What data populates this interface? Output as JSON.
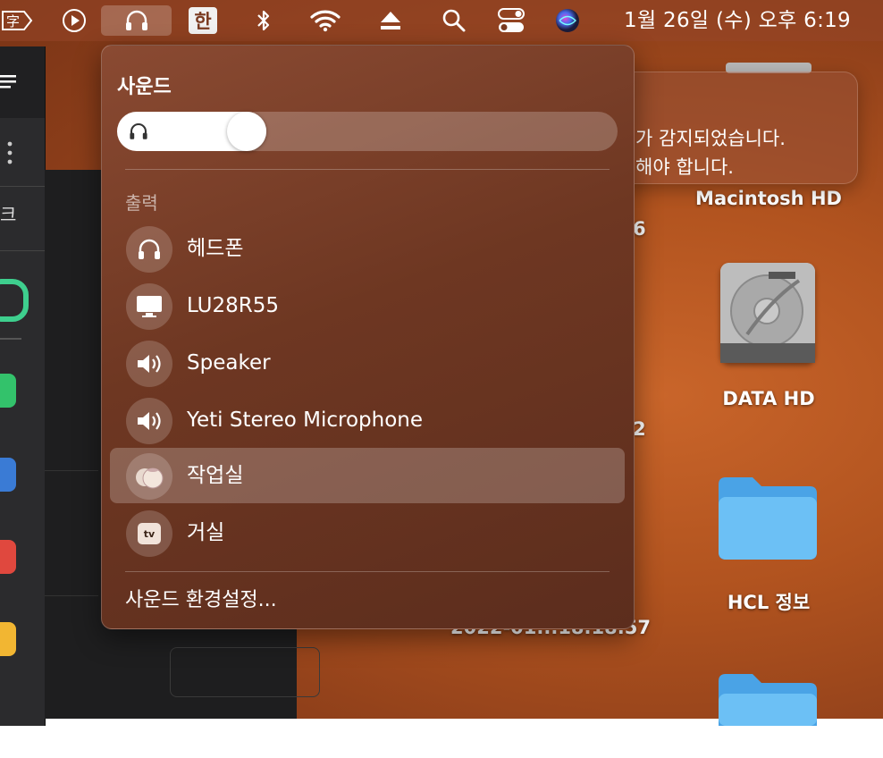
{
  "menubar": {
    "clock": "1월 26일 (수) 오후  6:19",
    "input_method_label": "한",
    "input_method_left": "字"
  },
  "sound_menu": {
    "title": "사운드",
    "volume_percent": 22,
    "output_section": "출력",
    "devices": [
      {
        "label": "헤드폰",
        "icon": "headphones-icon",
        "selected": false
      },
      {
        "label": "LU28R55",
        "icon": "display-icon",
        "selected": false
      },
      {
        "label": "Speaker",
        "icon": "speaker-icon",
        "selected": false
      },
      {
        "label": "Yeti Stereo Microphone",
        "icon": "speaker-icon",
        "selected": false
      },
      {
        "label": "작업실",
        "icon": "homepod-icon",
        "selected": true
      },
      {
        "label": "거실",
        "icon": "appletv-icon",
        "selected": false
      }
    ],
    "appletv_badge": "tv",
    "footer": "사운드 환경설정..."
  },
  "notification": {
    "line1": "가 감지되었습니다.",
    "line2": "해야 합니다."
  },
  "desktop": {
    "icons": [
      {
        "label": "Macintosh HD"
      },
      {
        "label": "DATA HD"
      },
      {
        "label": "HCL 정보"
      }
    ],
    "partial_texts": [
      "6",
      "2",
      "2022-01...18.18.57"
    ]
  },
  "left_app": {
    "partial_label": "크"
  },
  "colors": {
    "menu_bg": "#6e3722",
    "desktop_bg": "#b1531f",
    "folder_blue": "#5fb3ee"
  }
}
